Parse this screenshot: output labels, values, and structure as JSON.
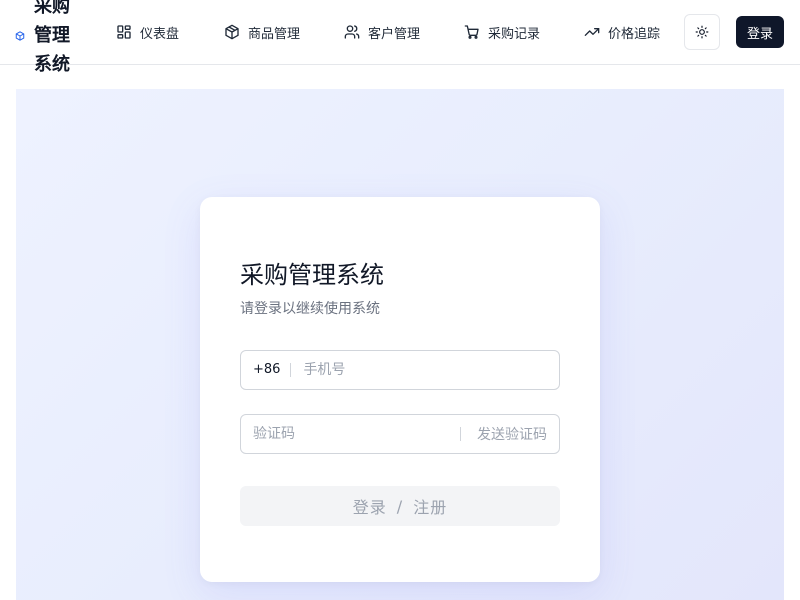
{
  "brand": {
    "name": "采购管理系统"
  },
  "nav": [
    {
      "id": "dashboard",
      "label": "仪表盘",
      "icon": "dashboard-icon"
    },
    {
      "id": "products",
      "label": "商品管理",
      "icon": "package-icon"
    },
    {
      "id": "customers",
      "label": "客户管理",
      "icon": "users-icon"
    },
    {
      "id": "purchases",
      "label": "采购记录",
      "icon": "cart-icon"
    },
    {
      "id": "price",
      "label": "价格追踪",
      "icon": "trending-up-icon"
    }
  ],
  "header": {
    "theme_icon": "sun-icon",
    "login_label": "登录"
  },
  "login": {
    "title": "采购管理系统",
    "subtitle": "请登录以继续使用系统",
    "phone_prefix": "+86",
    "phone_placeholder": "手机号",
    "code_placeholder": "验证码",
    "send_code_label": "发送验证码",
    "submit_login": "登录",
    "submit_sep": "/",
    "submit_register": "注册"
  },
  "colors": {
    "primary": "#0f172a",
    "accent": "#2563eb",
    "hero_bg": "#eef2ff"
  }
}
